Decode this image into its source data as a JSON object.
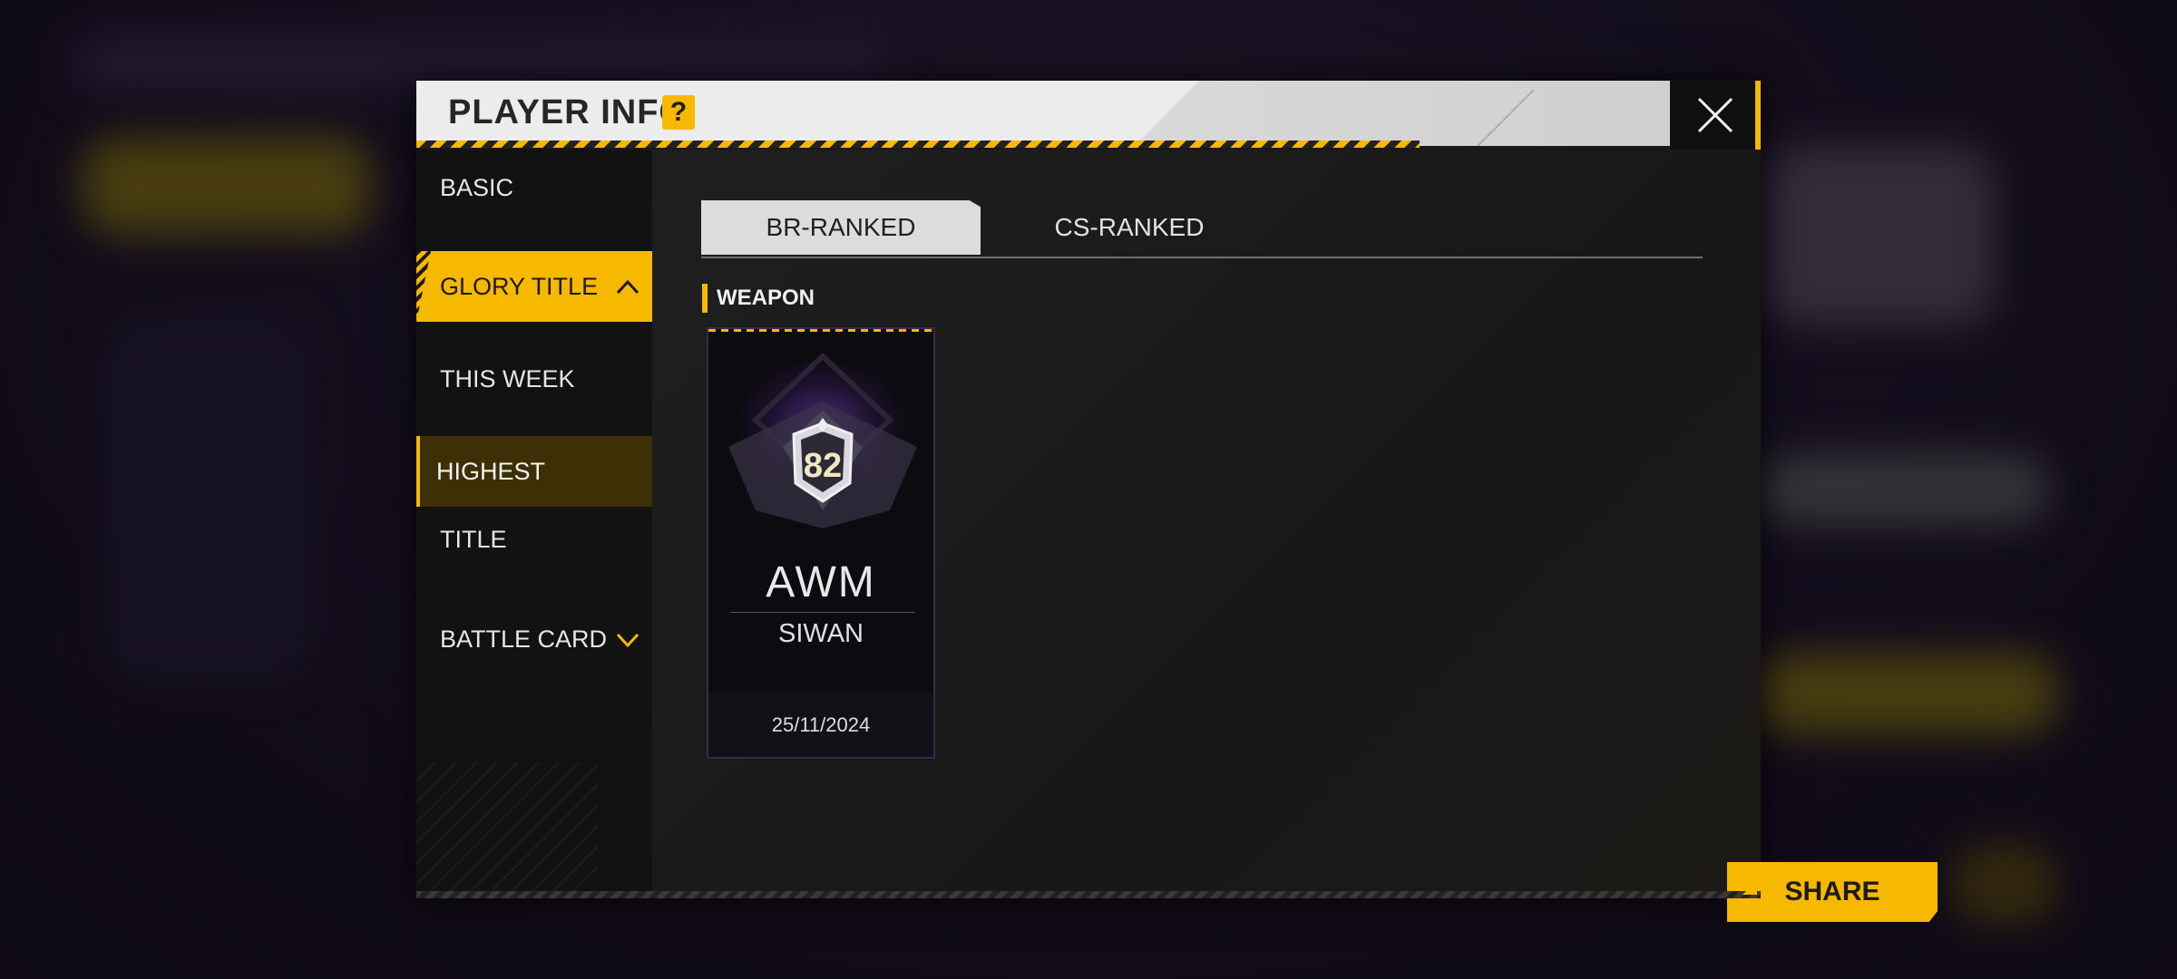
{
  "dialog": {
    "title": "PLAYER INFO",
    "help_icon": "question-mark-icon",
    "close_icon": "close-icon"
  },
  "sidebar": {
    "items": [
      {
        "label": "BASIC"
      },
      {
        "label": "GLORY TITLE",
        "icon": "chevron-up-icon"
      },
      {
        "label": "THIS WEEK"
      },
      {
        "label": "HIGHEST"
      },
      {
        "label": "TITLE"
      },
      {
        "label": "BATTLE CARD",
        "icon": "chevron-down-icon"
      }
    ]
  },
  "tabs": [
    {
      "label": "BR-RANKED",
      "active": true
    },
    {
      "label": "CS-RANKED",
      "active": false
    }
  ],
  "section": {
    "label": "WEAPON"
  },
  "card": {
    "badge_number": "82",
    "weapon": "AWM",
    "player": "SIWAN",
    "date": "25/11/2024"
  },
  "share_button": {
    "label": "SHARE"
  },
  "colors": {
    "accent": "#f7b800",
    "panel": "#191919"
  }
}
